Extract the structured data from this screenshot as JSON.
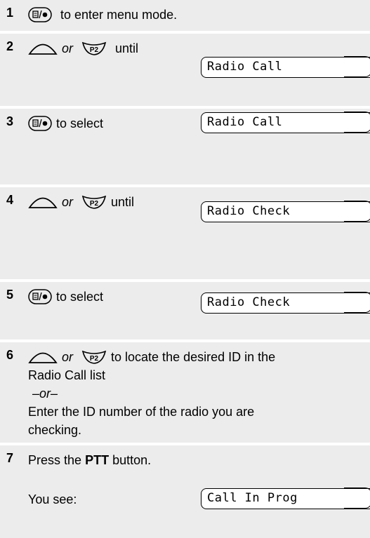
{
  "steps": [
    {
      "number": "1",
      "text": "to enter menu mode."
    },
    {
      "number": "2",
      "or": "or",
      "until": "until",
      "display": "Radio Call"
    },
    {
      "number": "3",
      "text": "to select",
      "display": "Radio Call"
    },
    {
      "number": "4",
      "or": "or",
      "until": "until",
      "display": "Radio Check"
    },
    {
      "number": "5",
      "text": "to select",
      "display": "Radio Check"
    },
    {
      "number": "6",
      "or": "or",
      "text_a": "to locate the desired ID in the",
      "text_b": "Radio Call list",
      "alt": "–or–",
      "text_c": "Enter the ID number of the radio you are",
      "text_d": "checking."
    },
    {
      "number": "7",
      "press": "Press the",
      "ptt": "PTT",
      "button": "button.",
      "see": "You see:",
      "display": "Call In Prog"
    }
  ],
  "icons": {
    "menu": "menu-select-key-icon",
    "up": "up-arrow-key-icon",
    "down": "p2-down-key-icon"
  }
}
